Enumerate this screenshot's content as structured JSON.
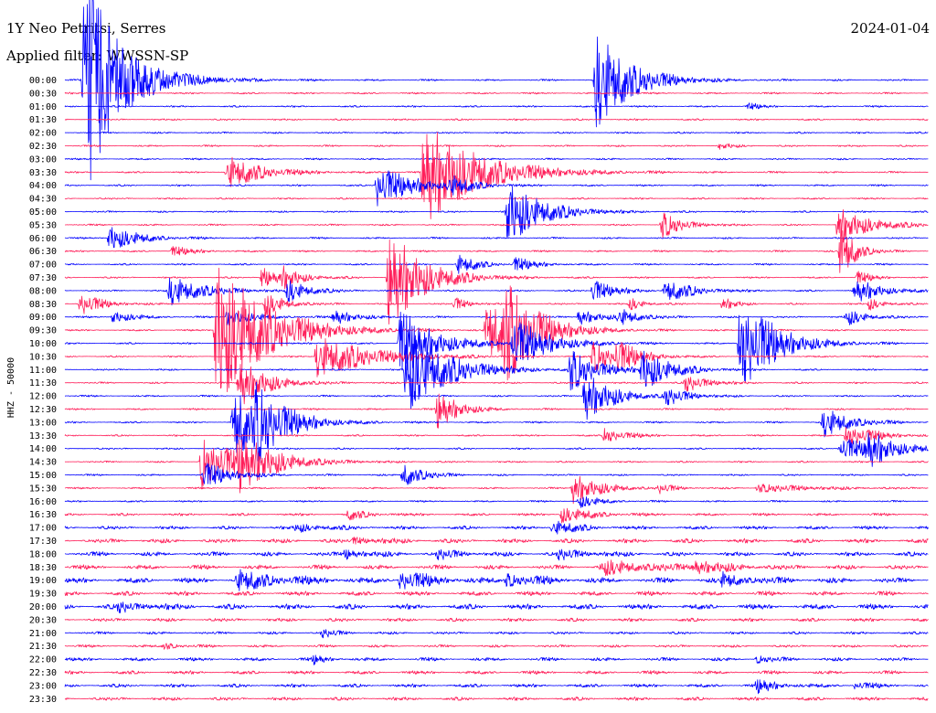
{
  "chart_data": {
    "type": "line",
    "title": "1Y Neo Petritsi, Serres",
    "subtitle": "Applied filter: WWSSN-SP",
    "date": "2024-01-04",
    "ylabel": "HHZ - 50000",
    "row_labels": [
      "00:00",
      "00:30",
      "01:00",
      "01:30",
      "02:00",
      "02:30",
      "03:00",
      "03:30",
      "04:00",
      "04:30",
      "05:00",
      "05:30",
      "06:00",
      "06:30",
      "07:00",
      "07:30",
      "08:00",
      "08:30",
      "09:00",
      "09:30",
      "10:00",
      "10:30",
      "11:00",
      "11:30",
      "12:00",
      "12:30",
      "13:00",
      "13:30",
      "14:00",
      "14:30",
      "15:00",
      "15:30",
      "16:00",
      "16:30",
      "17:00",
      "17:30",
      "18:00",
      "18:30",
      "19:00",
      "19:30",
      "20:00",
      "20:30",
      "21:00",
      "21:30",
      "22:00",
      "22:30",
      "23:00",
      "23:30"
    ],
    "colors": {
      "even": "#0000ff",
      "odd": "#ff1f5a",
      "text": "#000000"
    },
    "background_noise_by_row": [
      1,
      1,
      1,
      1,
      1,
      1,
      1,
      1,
      1,
      1,
      1,
      1,
      1,
      1,
      1,
      1,
      1,
      1,
      1,
      1,
      1,
      1,
      1,
      1,
      1,
      1,
      1,
      1,
      1,
      1,
      1,
      1,
      1,
      1.5,
      2,
      2.5,
      2.5,
      2.5,
      3,
      2.5,
      3,
      2,
      1.5,
      1.5,
      2,
      2,
      2,
      2
    ],
    "events": [
      {
        "row": 0,
        "minute": 18.4,
        "peak": 60,
        "duration_min": 2.5
      },
      {
        "row": 0,
        "minute": 0.8,
        "peak": 45,
        "duration_min": 1.5
      },
      {
        "row": 0,
        "minute": 0.6,
        "peak": 90,
        "duration_min": 3
      },
      {
        "row": 2,
        "minute": 23.7,
        "peak": 4,
        "duration_min": 1
      },
      {
        "row": 5,
        "minute": 22.7,
        "peak": 4,
        "duration_min": 1
      },
      {
        "row": 7,
        "minute": 12.4,
        "peak": 60,
        "duration_min": 4
      },
      {
        "row": 7,
        "minute": 5.6,
        "peak": 20,
        "duration_min": 2.5
      },
      {
        "row": 8,
        "minute": 10.8,
        "peak": 25,
        "duration_min": 2.5
      },
      {
        "row": 8,
        "minute": 13.3,
        "peak": 12,
        "duration_min": 1.5
      },
      {
        "row": 10,
        "minute": 15.3,
        "peak": 40,
        "duration_min": 2.5
      },
      {
        "row": 11,
        "minute": 26.8,
        "peak": 20,
        "duration_min": 2.5
      },
      {
        "row": 11,
        "minute": 20.7,
        "peak": 16,
        "duration_min": 1.5
      },
      {
        "row": 12,
        "minute": 1.5,
        "peak": 16,
        "duration_min": 2
      },
      {
        "row": 13,
        "minute": 3.7,
        "peak": 6,
        "duration_min": 1.5
      },
      {
        "row": 13,
        "minute": 26.9,
        "peak": 40,
        "duration_min": 1
      },
      {
        "row": 14,
        "minute": 13.6,
        "peak": 12,
        "duration_min": 1.5
      },
      {
        "row": 14,
        "minute": 15.6,
        "peak": 8,
        "duration_min": 1.5
      },
      {
        "row": 15,
        "minute": 11.2,
        "peak": 60,
        "duration_min": 2.5
      },
      {
        "row": 15,
        "minute": 6.8,
        "peak": 12,
        "duration_min": 1.5
      },
      {
        "row": 15,
        "minute": 7.5,
        "peak": 10,
        "duration_min": 1.5
      },
      {
        "row": 15,
        "minute": 27.5,
        "peak": 8,
        "duration_min": 1
      },
      {
        "row": 16,
        "minute": 3.6,
        "peak": 18,
        "duration_min": 2.5
      },
      {
        "row": 16,
        "minute": 7.7,
        "peak": 14,
        "duration_min": 1.5
      },
      {
        "row": 16,
        "minute": 18.3,
        "peak": 14,
        "duration_min": 1.5
      },
      {
        "row": 16,
        "minute": 20.8,
        "peak": 14,
        "duration_min": 2
      },
      {
        "row": 16,
        "minute": 27.4,
        "peak": 14,
        "duration_min": 2
      },
      {
        "row": 17,
        "minute": 0.5,
        "peak": 14,
        "duration_min": 1.5
      },
      {
        "row": 17,
        "minute": 6.9,
        "peak": 14,
        "duration_min": 1.5
      },
      {
        "row": 17,
        "minute": 13.5,
        "peak": 8,
        "duration_min": 1
      },
      {
        "row": 17,
        "minute": 19.6,
        "peak": 8,
        "duration_min": 1
      },
      {
        "row": 17,
        "minute": 22.8,
        "peak": 8,
        "duration_min": 1
      },
      {
        "row": 17,
        "minute": 27.9,
        "peak": 8,
        "duration_min": 1
      },
      {
        "row": 18,
        "minute": 1.6,
        "peak": 8,
        "duration_min": 1.5
      },
      {
        "row": 18,
        "minute": 5.6,
        "peak": 10,
        "duration_min": 2
      },
      {
        "row": 18,
        "minute": 9.3,
        "peak": 10,
        "duration_min": 1.5
      },
      {
        "row": 18,
        "minute": 17.8,
        "peak": 10,
        "duration_min": 1.5
      },
      {
        "row": 18,
        "minute": 19.2,
        "peak": 10,
        "duration_min": 1.5
      },
      {
        "row": 18,
        "minute": 27.1,
        "peak": 10,
        "duration_min": 1.5
      },
      {
        "row": 19,
        "minute": 5.2,
        "peak": 90,
        "duration_min": 3.5
      },
      {
        "row": 19,
        "minute": 15.2,
        "peak": 50,
        "duration_min": 2.5
      },
      {
        "row": 19,
        "minute": 14.6,
        "peak": 40,
        "duration_min": 2
      },
      {
        "row": 20,
        "minute": 15.5,
        "peak": 30,
        "duration_min": 2.5
      },
      {
        "row": 20,
        "minute": 23.4,
        "peak": 60,
        "duration_min": 2.5
      },
      {
        "row": 20,
        "minute": 11.6,
        "peak": 40,
        "duration_min": 2.5
      },
      {
        "row": 21,
        "minute": 8.7,
        "peak": 25,
        "duration_min": 4
      },
      {
        "row": 21,
        "minute": 18.3,
        "peak": 18,
        "duration_min": 2
      },
      {
        "row": 21,
        "minute": 19.1,
        "peak": 15,
        "duration_min": 1.5
      },
      {
        "row": 22,
        "minute": 11.8,
        "peak": 50,
        "duration_min": 3
      },
      {
        "row": 22,
        "minute": 17.5,
        "peak": 25,
        "duration_min": 2
      },
      {
        "row": 22,
        "minute": 20.0,
        "peak": 25,
        "duration_min": 2
      },
      {
        "row": 23,
        "minute": 6.0,
        "peak": 30,
        "duration_min": 2
      },
      {
        "row": 23,
        "minute": 21.5,
        "peak": 12,
        "duration_min": 1.5
      },
      {
        "row": 24,
        "minute": 18.0,
        "peak": 30,
        "duration_min": 2
      },
      {
        "row": 24,
        "minute": 20.8,
        "peak": 12,
        "duration_min": 1.5
      },
      {
        "row": 25,
        "minute": 12.9,
        "peak": 25,
        "duration_min": 1.5
      },
      {
        "row": 26,
        "minute": 26.3,
        "peak": 18,
        "duration_min": 2
      },
      {
        "row": 26,
        "minute": 5.8,
        "peak": 45,
        "duration_min": 2.5
      },
      {
        "row": 26,
        "minute": 6.6,
        "peak": 30,
        "duration_min": 2
      },
      {
        "row": 27,
        "minute": 27.1,
        "peak": 14,
        "duration_min": 2
      },
      {
        "row": 27,
        "minute": 18.7,
        "peak": 10,
        "duration_min": 1.5
      },
      {
        "row": 28,
        "minute": 26.9,
        "peak": 14,
        "duration_min": 2.5
      },
      {
        "row": 28,
        "minute": 27.8,
        "peak": 18,
        "duration_min": 2
      },
      {
        "row": 29,
        "minute": 4.7,
        "peak": 30,
        "duration_min": 3
      },
      {
        "row": 29,
        "minute": 6.0,
        "peak": 25,
        "duration_min": 2.5
      },
      {
        "row": 30,
        "minute": 4.8,
        "peak": 15,
        "duration_min": 2
      },
      {
        "row": 30,
        "minute": 11.7,
        "peak": 15,
        "duration_min": 1.5
      },
      {
        "row": 31,
        "minute": 17.6,
        "peak": 18,
        "duration_min": 2
      },
      {
        "row": 31,
        "minute": 20.6,
        "peak": 6,
        "duration_min": 1
      },
      {
        "row": 31,
        "minute": 24.0,
        "peak": 5,
        "duration_min": 4
      },
      {
        "row": 32,
        "minute": 17.8,
        "peak": 8,
        "duration_min": 1.5
      },
      {
        "row": 33,
        "minute": 17.2,
        "peak": 10,
        "duration_min": 2
      },
      {
        "row": 33,
        "minute": 9.8,
        "peak": 6,
        "duration_min": 1.5
      },
      {
        "row": 34,
        "minute": 16.9,
        "peak": 10,
        "duration_min": 1.5
      },
      {
        "row": 34,
        "minute": 8.0,
        "peak": 5,
        "duration_min": 2
      },
      {
        "row": 35,
        "minute": 10.0,
        "peak": 4,
        "duration_min": 2
      },
      {
        "row": 36,
        "minute": 9.7,
        "peak": 6,
        "duration_min": 1.5
      },
      {
        "row": 36,
        "minute": 12.9,
        "peak": 6,
        "duration_min": 1.5
      },
      {
        "row": 36,
        "minute": 17.1,
        "peak": 6,
        "duration_min": 2
      },
      {
        "row": 37,
        "minute": 18.6,
        "peak": 8,
        "duration_min": 4
      },
      {
        "row": 37,
        "minute": 21.8,
        "peak": 8,
        "duration_min": 2
      },
      {
        "row": 38,
        "minute": 5.9,
        "peak": 12,
        "duration_min": 3
      },
      {
        "row": 38,
        "minute": 11.6,
        "peak": 12,
        "duration_min": 2
      },
      {
        "row": 38,
        "minute": 15.3,
        "peak": 8,
        "duration_min": 2
      },
      {
        "row": 38,
        "minute": 22.8,
        "peak": 8,
        "duration_min": 2
      },
      {
        "row": 40,
        "minute": 1.8,
        "peak": 6,
        "duration_min": 2
      },
      {
        "row": 42,
        "minute": 8.9,
        "peak": 6,
        "duration_min": 1
      },
      {
        "row": 43,
        "minute": 3.4,
        "peak": 5,
        "duration_min": 1
      },
      {
        "row": 44,
        "minute": 8.6,
        "peak": 5,
        "duration_min": 1
      },
      {
        "row": 44,
        "minute": 24.0,
        "peak": 5,
        "duration_min": 1
      },
      {
        "row": 46,
        "minute": 24.0,
        "peak": 8,
        "duration_min": 1.5
      },
      {
        "row": 46,
        "minute": 27.4,
        "peak": 5,
        "duration_min": 1
      }
    ]
  }
}
